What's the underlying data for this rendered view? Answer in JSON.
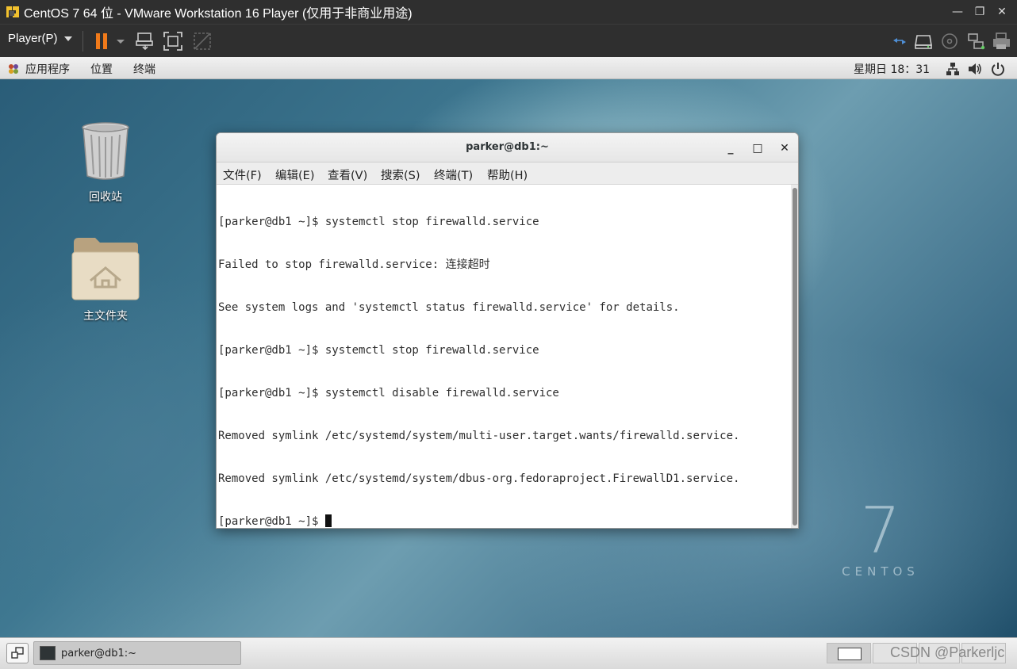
{
  "vmware": {
    "title": "CentOS 7 64 位 - VMware Workstation 16 Player (仅用于非商业用途)",
    "player_menu": "Player(P)",
    "toolbar_icons": [
      "pause-icon",
      "send-ctrl-alt-del-icon",
      "fullscreen-icon",
      "unity-icon"
    ],
    "status_icons": [
      "network-adapter-icon",
      "hard-disk-icon",
      "cd-rom-icon",
      "usb-icon",
      "printer-icon"
    ],
    "accent": "#f07a1a"
  },
  "gnome": {
    "menus": [
      "应用程序",
      "位置",
      "终端"
    ],
    "clock": "星期日 18：31",
    "tray_icons": [
      "network-icon",
      "volume-icon",
      "power-icon"
    ]
  },
  "desktop": {
    "icons": [
      {
        "label": "回收站",
        "icon": "trash-icon"
      },
      {
        "label": "主文件夹",
        "icon": "home-folder-icon"
      }
    ],
    "watermark_number": "7",
    "watermark_word": "CENTOS"
  },
  "terminal": {
    "title": "parker@db1:~",
    "menus": [
      "文件(F)",
      "编辑(E)",
      "查看(V)",
      "搜索(S)",
      "终端(T)",
      "帮助(H)"
    ],
    "lines": [
      "[parker@db1 ~]$ systemctl stop firewalld.service",
      "Failed to stop firewalld.service: 连接超时",
      "See system logs and 'systemctl status firewalld.service' for details.",
      "[parker@db1 ~]$ systemctl stop firewalld.service",
      "[parker@db1 ~]$ systemctl disable firewalld.service",
      "Removed symlink /etc/systemd/system/multi-user.target.wants/firewalld.service.",
      "Removed symlink /etc/systemd/system/dbus-org.fedoraproject.FirewallD1.service."
    ],
    "prompt": "[parker@db1 ~]$ "
  },
  "taskbar": {
    "task_label": "parker@db1:~",
    "watermark": "CSDN @Parkerljc"
  }
}
